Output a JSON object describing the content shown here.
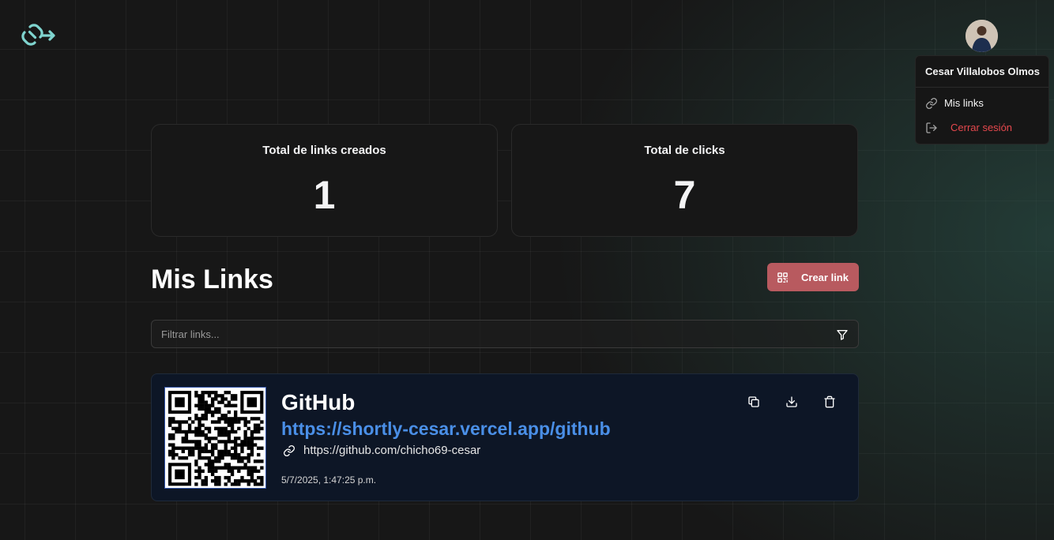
{
  "header": {
    "logo_icon": "link-arrow-icon",
    "avatar_icon": "user-avatar"
  },
  "user_menu": {
    "name": "Cesar Villalobos Olmos",
    "items": [
      {
        "label": "Mis links",
        "icon": "link-icon"
      },
      {
        "label": "Cerrar sesión",
        "icon": "logout-icon",
        "color": "#e5484d"
      }
    ]
  },
  "stats": [
    {
      "title": "Total de links creados",
      "value": "1"
    },
    {
      "title": "Total de clicks",
      "value": "7"
    }
  ],
  "main": {
    "title": "Mis Links",
    "create_button": "Crear link",
    "filter_placeholder": "Filtrar links..."
  },
  "links": [
    {
      "title": "GitHub",
      "short_url": "https://shortly-cesar.vercel.app/github",
      "original_url": "https://github.com/chicho69-cesar",
      "created": "5/7/2025, 1:47:25 p.m."
    }
  ],
  "colors": {
    "accent_button": "#b85a5f",
    "link_blue": "#4a8fe7",
    "logo_teal": "#7fd4cf",
    "danger": "#e5484d"
  }
}
